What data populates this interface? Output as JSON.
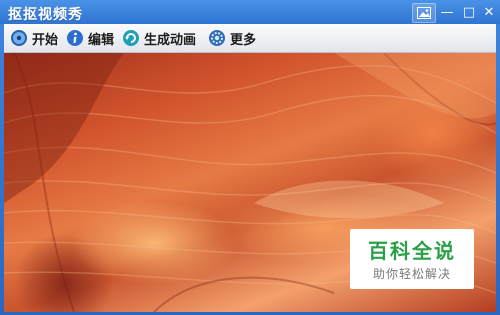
{
  "window": {
    "title": "抠抠视频秀",
    "accent": "#2f74d2"
  },
  "titlebar_buttons": {
    "skin_icon": "picture-icon",
    "minimize_label": "—",
    "maximize_label": "□",
    "close_label": "✕"
  },
  "toolbar": {
    "items": [
      {
        "label": "开始",
        "icon": "play-disc-icon"
      },
      {
        "label": "编辑",
        "icon": "info-icon"
      },
      {
        "label": "生成动画",
        "icon": "refresh-icon"
      },
      {
        "label": "更多",
        "icon": "gear-icon"
      }
    ]
  },
  "preview": {
    "description_icon": "canyon-photo"
  },
  "watermark": {
    "main": "百科全说",
    "sub": "助你轻松解决",
    "color": "#2aa147"
  }
}
